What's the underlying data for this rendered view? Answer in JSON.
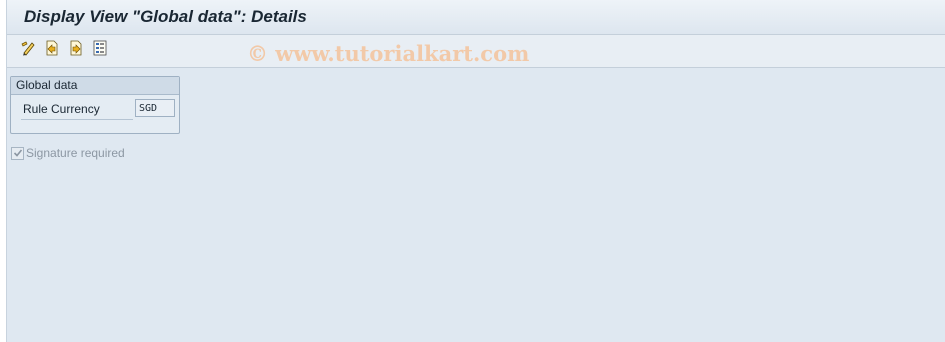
{
  "window": {
    "title": "Display View \"Global data\": Details"
  },
  "toolbar": {
    "buttons": [
      {
        "icon": "display-change-icon"
      },
      {
        "icon": "previous-entry-icon"
      },
      {
        "icon": "next-entry-icon"
      },
      {
        "icon": "variable-list-icon"
      }
    ],
    "watermark": "© www.tutorialkart.com"
  },
  "group": {
    "header": "Global data",
    "field_label": "Rule Currency",
    "field_value": "SGD"
  },
  "signature": {
    "label": "Signature required",
    "checked": true
  },
  "colors": {
    "background": "#dfe8f1",
    "watermark": "#f2c9a8"
  }
}
